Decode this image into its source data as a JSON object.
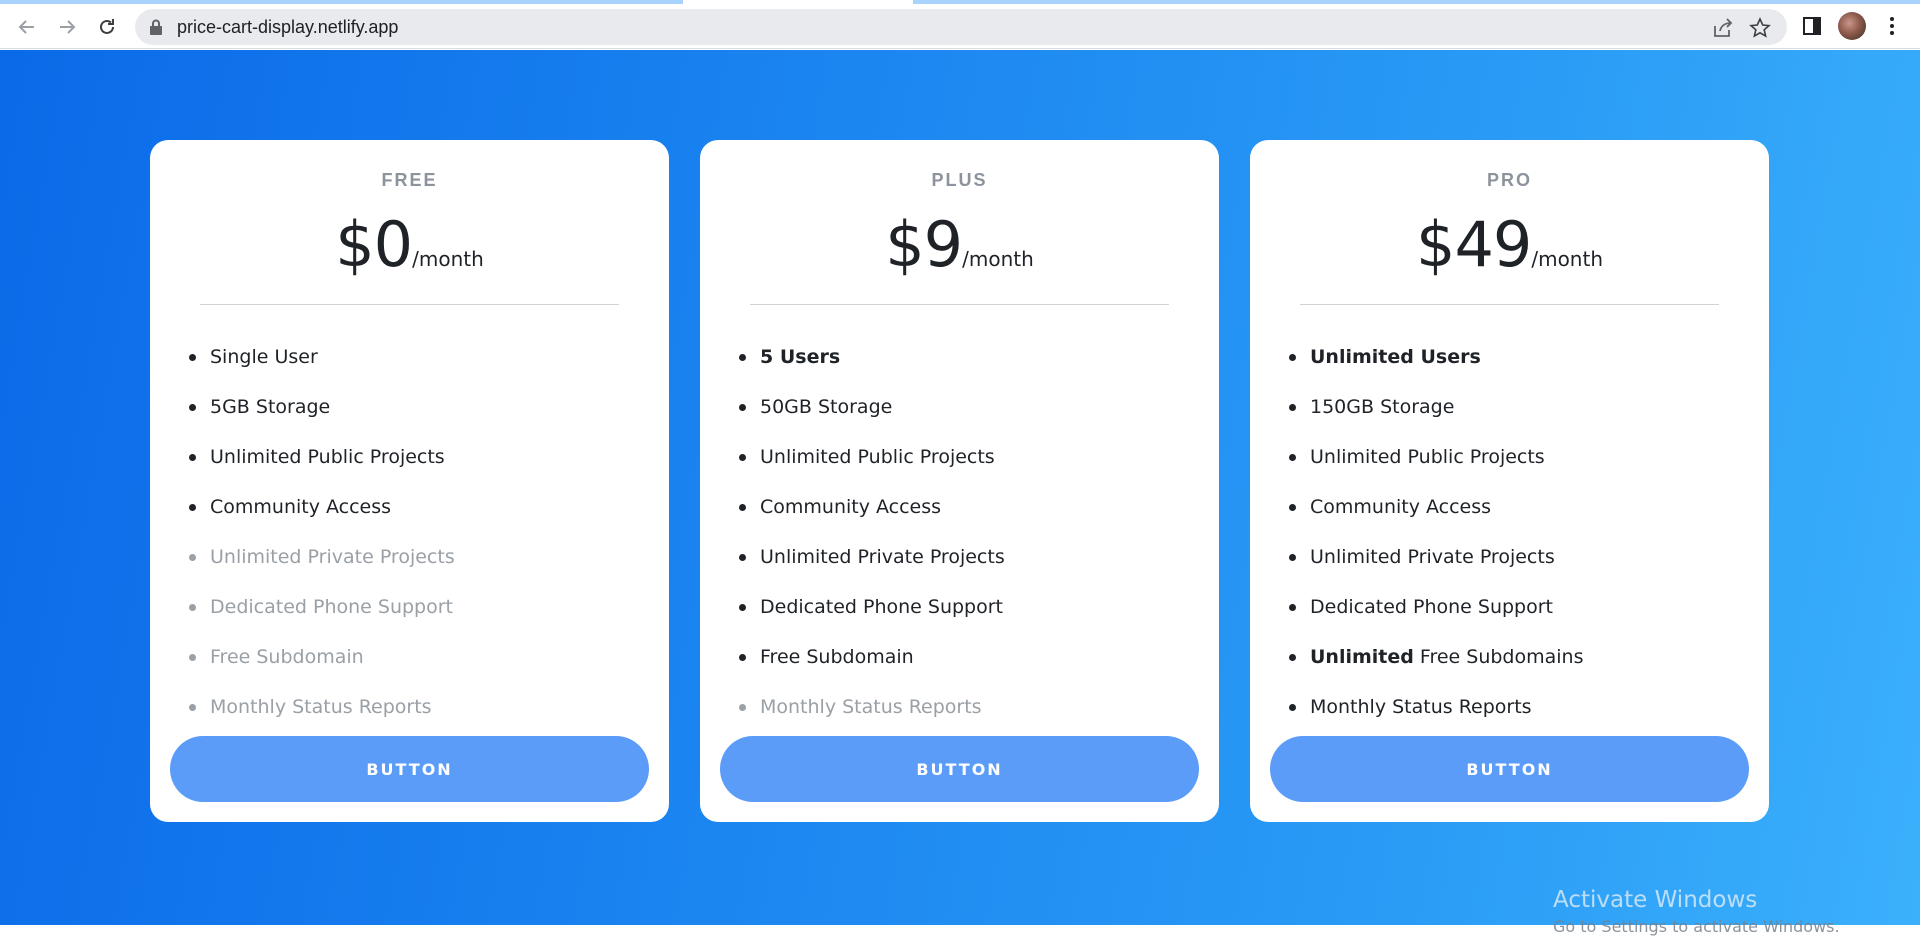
{
  "browser": {
    "url": "price-cart-display.netlify.app",
    "icons": [
      "back-icon",
      "forward-icon",
      "reload-icon",
      "lock-icon",
      "share-icon",
      "star-icon",
      "sidebar-icon",
      "avatar",
      "menu-icon"
    ]
  },
  "colors": {
    "gradient_start": "#0a6ae8",
    "gradient_end": "#3bb0fb",
    "button": "#5b9cf9",
    "text_dark": "#1f2328",
    "text_muted": "#9aa0a6",
    "plan_label": "#8c939c"
  },
  "plans": [
    {
      "name": "FREE",
      "price": "$0",
      "period": "/month",
      "button_label": "BUTTON",
      "features": [
        {
          "bold": "",
          "text": "Single User",
          "muted": false
        },
        {
          "bold": "",
          "text": "5GB Storage",
          "muted": false
        },
        {
          "bold": "",
          "text": "Unlimited Public Projects",
          "muted": false
        },
        {
          "bold": "",
          "text": "Community Access",
          "muted": false
        },
        {
          "bold": "",
          "text": "Unlimited Private Projects",
          "muted": true
        },
        {
          "bold": "",
          "text": "Dedicated Phone Support",
          "muted": true
        },
        {
          "bold": "",
          "text": "Free Subdomain",
          "muted": true
        },
        {
          "bold": "",
          "text": "Monthly Status Reports",
          "muted": true
        }
      ]
    },
    {
      "name": "PLUS",
      "price": "$9",
      "period": "/month",
      "button_label": "BUTTON",
      "features": [
        {
          "bold": "5 Users",
          "text": "",
          "muted": false
        },
        {
          "bold": "",
          "text": "50GB Storage",
          "muted": false
        },
        {
          "bold": "",
          "text": "Unlimited Public Projects",
          "muted": false
        },
        {
          "bold": "",
          "text": "Community Access",
          "muted": false
        },
        {
          "bold": "",
          "text": "Unlimited Private Projects",
          "muted": false
        },
        {
          "bold": "",
          "text": "Dedicated Phone Support",
          "muted": false
        },
        {
          "bold": "",
          "text": "Free Subdomain",
          "muted": false
        },
        {
          "bold": "",
          "text": "Monthly Status Reports",
          "muted": true
        }
      ]
    },
    {
      "name": "PRO",
      "price": "$49",
      "period": "/month",
      "button_label": "BUTTON",
      "features": [
        {
          "bold": "Unlimited Users",
          "text": "",
          "muted": false
        },
        {
          "bold": "",
          "text": "150GB Storage",
          "muted": false
        },
        {
          "bold": "",
          "text": "Unlimited Public Projects",
          "muted": false
        },
        {
          "bold": "",
          "text": "Community Access",
          "muted": false
        },
        {
          "bold": "",
          "text": "Unlimited Private Projects",
          "muted": false
        },
        {
          "bold": "",
          "text": "Dedicated Phone Support",
          "muted": false
        },
        {
          "bold": "Unlimited",
          "text": " Free Subdomains",
          "muted": false
        },
        {
          "bold": "",
          "text": "Monthly Status Reports",
          "muted": false
        }
      ]
    }
  ],
  "watermark": {
    "title": "Activate Windows",
    "subtitle": "Go to Settings to activate Windows."
  }
}
